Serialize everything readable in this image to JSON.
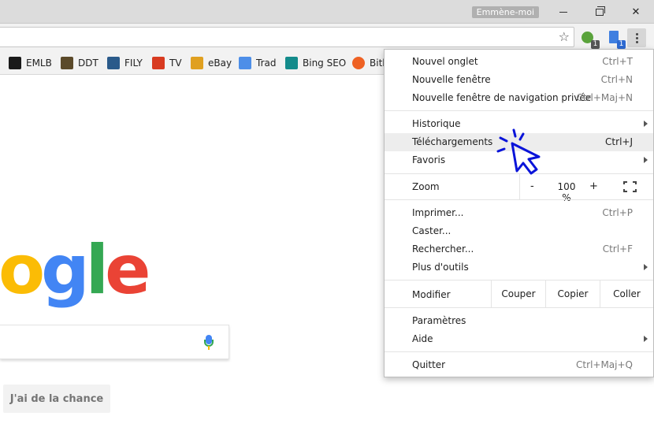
{
  "titlebar": {
    "user": "Emmène-moi"
  },
  "extensions": [
    {
      "badge": "1"
    },
    {
      "badge": "1"
    }
  ],
  "bookmarks": [
    {
      "label": "EMLB",
      "color": "#1a1a1a"
    },
    {
      "label": "DDT",
      "color": "#5b4a2a"
    },
    {
      "label": "FILY",
      "color": "#2a5a8a"
    },
    {
      "label": "TV",
      "color": "#d83a20"
    },
    {
      "label": "eBay",
      "color": "#e0a020"
    },
    {
      "label": "Trad",
      "color": "#4d8ee8"
    },
    {
      "label": "Bing SEO",
      "color": "#138b8b"
    },
    {
      "label": "Bitl",
      "color": "#ee6123"
    }
  ],
  "logo": {
    "o": "o",
    "g": "g",
    "l": "l",
    "e": "e"
  },
  "content": {
    "lucky_button": "J'ai de la chance"
  },
  "menu": {
    "new_tab": {
      "label": "Nouvel onglet",
      "shortcut": "Ctrl+T"
    },
    "new_window": {
      "label": "Nouvelle fenêtre",
      "shortcut": "Ctrl+N"
    },
    "incognito": {
      "label": "Nouvelle fenêtre de navigation privée",
      "shortcut": "Ctrl+Maj+N"
    },
    "history": {
      "label": "Historique"
    },
    "downloads": {
      "label": "Téléchargements",
      "shortcut": "Ctrl+J"
    },
    "bookmarks": {
      "label": "Favoris"
    },
    "zoom": {
      "label": "Zoom",
      "minus": "-",
      "value": "100 %",
      "plus": "+"
    },
    "print": {
      "label": "Imprimer...",
      "shortcut": "Ctrl+P"
    },
    "cast": {
      "label": "Caster..."
    },
    "find": {
      "label": "Rechercher...",
      "shortcut": "Ctrl+F"
    },
    "more_tools": {
      "label": "Plus d'outils"
    },
    "edit": {
      "label": "Modifier",
      "cut": "Couper",
      "copy": "Copier",
      "paste": "Coller"
    },
    "settings": {
      "label": "Paramètres"
    },
    "help": {
      "label": "Aide"
    },
    "quit": {
      "label": "Quitter",
      "shortcut": "Ctrl+Maj+Q"
    }
  },
  "annotation": {
    "pointer_color": "#0a14d9"
  }
}
